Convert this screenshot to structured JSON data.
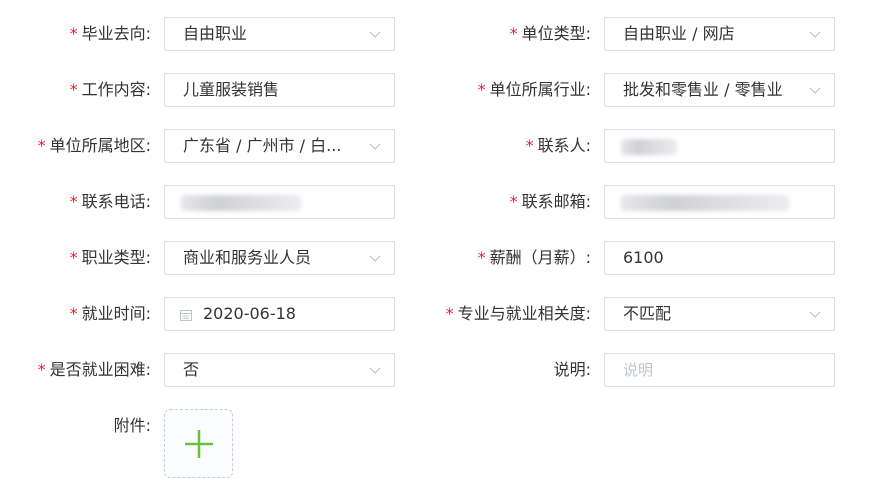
{
  "form": {
    "required_mark": "*",
    "graduation_destination": {
      "label": "毕业去向:",
      "value": "自由职业"
    },
    "employer_type": {
      "label": "单位类型:",
      "value": "自由职业 / 网店"
    },
    "job_content": {
      "label": "工作内容:",
      "value": "儿童服装销售"
    },
    "employer_industry": {
      "label": "单位所属行业:",
      "value": "批发和零售业 / 零售业"
    },
    "employer_region": {
      "label": "单位所属地区:",
      "value": "广东省 / 广州市 / 白..."
    },
    "contact_person": {
      "label": "联系人:"
    },
    "contact_phone": {
      "label": "联系电话:"
    },
    "contact_email": {
      "label": "联系邮箱:"
    },
    "occupation_type": {
      "label": "职业类型:",
      "value": "商业和服务业人员"
    },
    "salary": {
      "label": "薪酬（月薪）:",
      "value": "6100"
    },
    "employment_date": {
      "label": "就业时间:",
      "value": "2020-06-18"
    },
    "major_relevance": {
      "label": "专业与就业相关度:",
      "value": "不匹配"
    },
    "employment_difficulty": {
      "label": "是否就业困难:",
      "value": "否"
    },
    "remarks": {
      "label": "说明:",
      "placeholder": "说明"
    },
    "attachment": {
      "label": "附件:"
    }
  },
  "colors": {
    "required": "#f5222d",
    "border": "#dcdfe6",
    "text": "#333333",
    "placeholder": "#c0c4cc",
    "plus": "#67c23a"
  },
  "icons": {
    "select_arrow": "chevron-down-icon",
    "date": "calendar-icon",
    "upload": "plus-icon"
  }
}
